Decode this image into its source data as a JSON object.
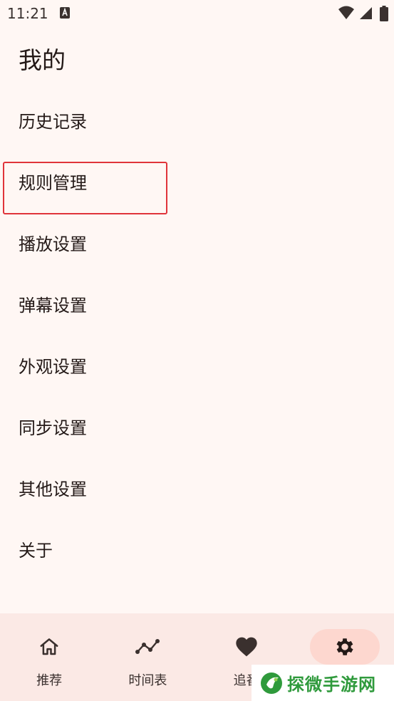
{
  "status_bar": {
    "time": "11:21"
  },
  "page": {
    "title": "我的"
  },
  "menu": {
    "items": [
      {
        "label": "历史记录"
      },
      {
        "label": "规则管理"
      },
      {
        "label": "播放设置"
      },
      {
        "label": "弹幕设置"
      },
      {
        "label": "外观设置"
      },
      {
        "label": "同步设置"
      },
      {
        "label": "其他设置"
      },
      {
        "label": "关于"
      }
    ]
  },
  "bottom_nav": {
    "items": [
      {
        "label": "推荐",
        "icon": "home-icon"
      },
      {
        "label": "时间表",
        "icon": "timeline-icon"
      },
      {
        "label": "追番",
        "icon": "heart-icon"
      },
      {
        "label": "",
        "icon": "gear-icon",
        "active": true
      }
    ]
  },
  "watermark": {
    "text": "探微手游网"
  },
  "colors": {
    "background": "#fff7f4",
    "nav_background": "#fbe9e5",
    "active_pill": "#fdd7cf",
    "highlight_border": "#e0343a",
    "watermark_green": "#2f9a3c"
  }
}
